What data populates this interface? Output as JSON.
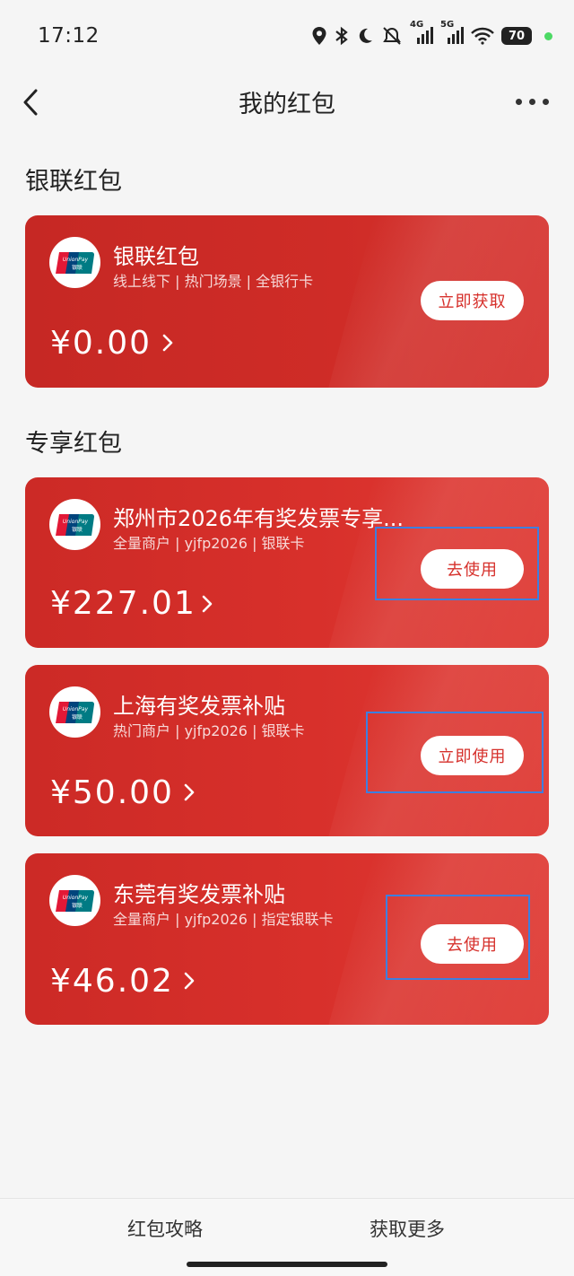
{
  "status_bar": {
    "time": "17:12",
    "network_4g": "4G",
    "network_5g": "5G",
    "battery": "70"
  },
  "nav": {
    "title": "我的红包"
  },
  "sections": {
    "unionpay_title": "银联红包",
    "exclusive_title": "专享红包"
  },
  "cards": [
    {
      "name": "银联红包",
      "desc": "线上线下 | 热门场景 | 全银行卡",
      "amount": "¥0.00",
      "button": "立即获取"
    },
    {
      "name": "郑州市2026年有奖发票专享...",
      "desc": "全量商户 | yjfp2026 | 银联卡",
      "amount": "¥227.01",
      "button": "去使用"
    },
    {
      "name": "上海有奖发票补贴",
      "desc": "热门商户 | yjfp2026 | 银联卡",
      "amount": "¥50.00",
      "button": "立即使用"
    },
    {
      "name": "东莞有奖发票补贴",
      "desc": "全量商户 | yjfp2026 | 指定银联卡",
      "amount": "¥46.02",
      "button": "去使用"
    }
  ],
  "bottom": {
    "tab_strategy": "红包攻略",
    "tab_more": "获取更多"
  },
  "colors": {
    "card_red": "#d8302b",
    "highlight_blue": "#3d7fe0"
  }
}
